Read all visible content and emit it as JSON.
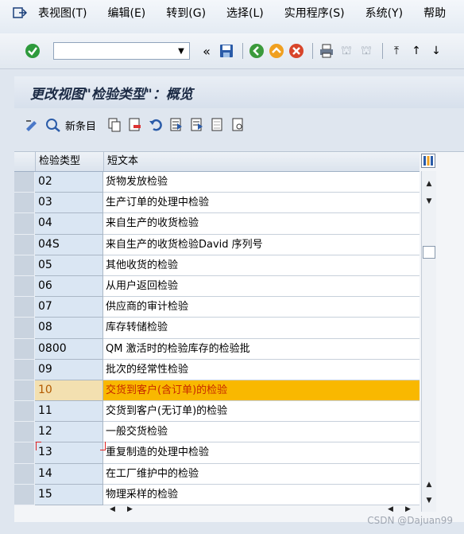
{
  "menubar": {
    "items": [
      "表视图(T)",
      "编辑(E)",
      "转到(G)",
      "选择(L)",
      "实用程序(S)",
      "系统(Y)",
      "帮助"
    ]
  },
  "toolbar": {
    "command_value": ""
  },
  "title": "更改视图\"检验类型\"：概览",
  "app_toolbar": {
    "new_entries_label": "新条目"
  },
  "table": {
    "columns": [
      "检验类型",
      "短文本"
    ],
    "rows": [
      {
        "code": "02",
        "text": "货物发放检验"
      },
      {
        "code": "03",
        "text": "生产订单的处理中检验"
      },
      {
        "code": "04",
        "text": "来自生产的收货检验"
      },
      {
        "code": "04S",
        "text": "来自生产的收货检验David 序列号"
      },
      {
        "code": "05",
        "text": "其他收货的检验"
      },
      {
        "code": "06",
        "text": "从用户返回检验"
      },
      {
        "code": "07",
        "text": "供应商的审计检验"
      },
      {
        "code": "08",
        "text": "库存转储检验"
      },
      {
        "code": "0800",
        "text": "QM 激活时的检验库存的检验批"
      },
      {
        "code": "09",
        "text": "批次的经常性检验"
      },
      {
        "code": "10",
        "text": "交货到客户(含订单)的检验"
      },
      {
        "code": "11",
        "text": "交货到客户(无订单)的检验"
      },
      {
        "code": "12",
        "text": "一般交货检验"
      },
      {
        "code": "13",
        "text": "重复制造的处理中检验"
      },
      {
        "code": "14",
        "text": "在工厂维护中的检验"
      },
      {
        "code": "15",
        "text": "物理采样的检验"
      }
    ],
    "highlighted_code": "10"
  },
  "watermark": "CSDN @Dajuan99",
  "colors": {
    "highlight_row": "#f9b800",
    "highlight_text": "#c62800",
    "key_column": "#dae6f3"
  }
}
